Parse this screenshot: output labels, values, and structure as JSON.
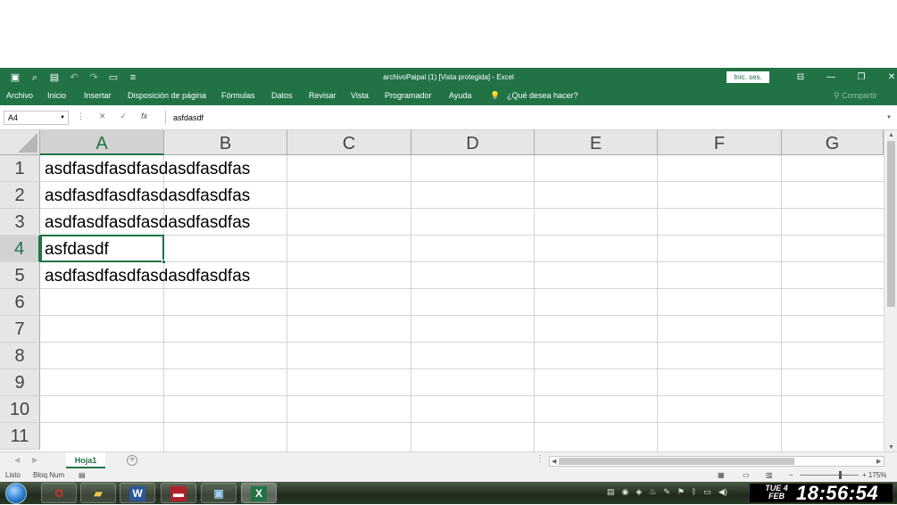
{
  "window": {
    "title": "archivoPaipal (1)  [Vista protegida]  -  Excel",
    "signin_label": "Inic. ses.",
    "qat_icons": [
      "save-icon",
      "print-preview-icon",
      "save-as-icon",
      "undo-icon",
      "redo-icon",
      "open-icon",
      "customize-icon"
    ]
  },
  "ribbon": {
    "tabs": [
      "Archivo",
      "Inicio",
      "Insertar",
      "Disposición de página",
      "Fórmulas",
      "Datos",
      "Revisar",
      "Vista",
      "Programador",
      "Ayuda"
    ],
    "tellme": "¿Qué desea hacer?",
    "share": "Compartir"
  },
  "formula_bar": {
    "name_box": "A4",
    "fx_label": "fx",
    "value": "asfdasdf"
  },
  "grid": {
    "columns": [
      "A",
      "B",
      "C",
      "D",
      "E",
      "F",
      "G"
    ],
    "rows": [
      "1",
      "2",
      "3",
      "4",
      "5",
      "6",
      "7",
      "8",
      "9",
      "10",
      "11"
    ],
    "cells": {
      "A1": "asdfasdfasdfasdasdfasdfas",
      "A2": "asdfasdfasdfasdasdfasdfas",
      "A3": "asdfasdfasdfasdasdfasdfas",
      "A4": "asfdasdf",
      "A5": "asdfasdfasdfasdasdfasdfas"
    },
    "active_cell": "A4"
  },
  "sheets": {
    "tabs": [
      "Hoja1"
    ],
    "active": "Hoja1"
  },
  "status": {
    "ready": "Listo",
    "num_lock": "Bloq Num",
    "zoom": "+ 175%"
  },
  "taskbar": {
    "apps": [
      "opera",
      "file-explorer",
      "word",
      "media",
      "remote-desktop",
      "excel"
    ],
    "clock_day": "TUE 4",
    "clock_month": "FEB",
    "clock_time": "18:56:54"
  },
  "colors": {
    "accent": "#217346",
    "header_bg": "#e6e6e6"
  }
}
